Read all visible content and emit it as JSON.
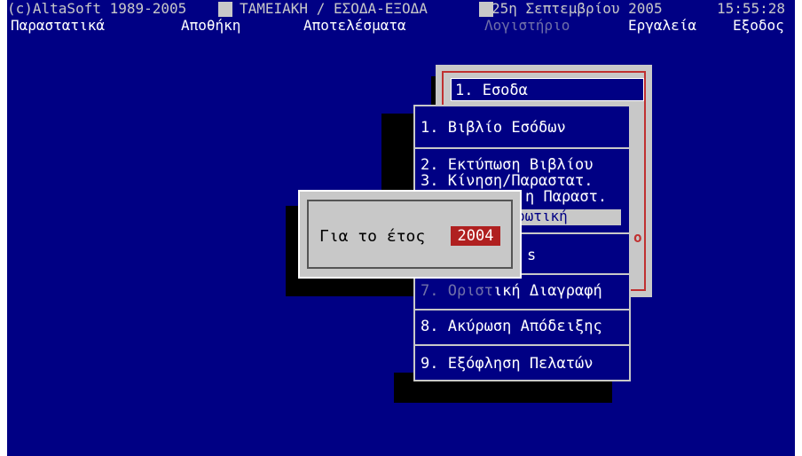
{
  "status": {
    "copyright": "(c)AltaSoft 1989-2005",
    "module": "ΤΑΜΕΙΑΚΗ / ΕΣΟΔΑ-ΕΞΟΔΑ",
    "date": "25η Σεπτεμβρίου  2005",
    "time": "15:55:28"
  },
  "menu": {
    "items": [
      {
        "label": "Παραστατικά"
      },
      {
        "label": "Αποθήκη"
      },
      {
        "label": "Αποτελέσματα"
      },
      {
        "label": "Λογιστήριο"
      },
      {
        "label": "Εργαλεία"
      },
      {
        "label": "Εξοδος"
      }
    ]
  },
  "back_submenu": {
    "highlighted": "1. Εσοδα",
    "partial_char": "ο"
  },
  "submenu": {
    "item1": "1. Βιβλίο Εσόδων",
    "item2": "2. Εκτύπωση Βιβλίου",
    "item3": "3. Κίνηση/Παραστατ.",
    "item4_partial": "η Παραστ.",
    "item5_partial": "ρωτική",
    "item6_partial": "s",
    "item7_dim": "7. Οριστ",
    "item7_rest": "ική Διαγραφή",
    "item8": "8. Ακύρωση Απόδειξης",
    "item9": "9. Εξόφληση Πελατών"
  },
  "dialog": {
    "label": "Για το έτος",
    "year_value": "2004"
  },
  "colors": {
    "background": "#000084",
    "panel": "#c8c8c8",
    "accent_red": "#b02020",
    "dim_text": "#7070a8"
  }
}
